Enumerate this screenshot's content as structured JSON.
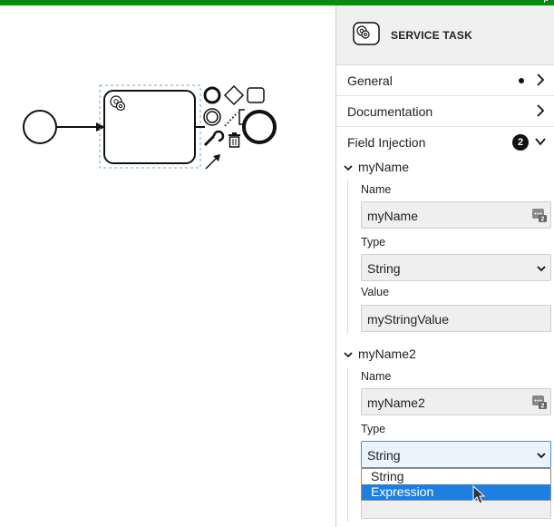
{
  "topbar": {
    "text": "p"
  },
  "panel": {
    "header": {
      "title": "SERVICE TASK",
      "icon": "service-task-gear-icon"
    },
    "groups": {
      "general": {
        "label": "General",
        "icon": "chevron-right-icon"
      },
      "documentation": {
        "label": "Documentation",
        "icon": "chevron-right-icon"
      },
      "field_injection": {
        "label": "Field Injection",
        "count": "2",
        "icon": "chevron-down-icon"
      }
    },
    "entries": [
      {
        "title": "myName",
        "name_label": "Name",
        "name_value": "myName",
        "type_label": "Type",
        "type_value": "String",
        "value_label": "Value",
        "value_value": "myStringValue"
      },
      {
        "title": "myName2",
        "name_label": "Name",
        "name_value": "myName2",
        "type_label": "Type",
        "type_value": "String"
      }
    ],
    "dropdown": {
      "options": [
        "String",
        "Expression"
      ],
      "highlighted": "Expression"
    }
  },
  "colors": {
    "accent_green": "#0a8a0a",
    "selection_blue": "#1e7fe0",
    "focus_border": "#4a90d9"
  }
}
